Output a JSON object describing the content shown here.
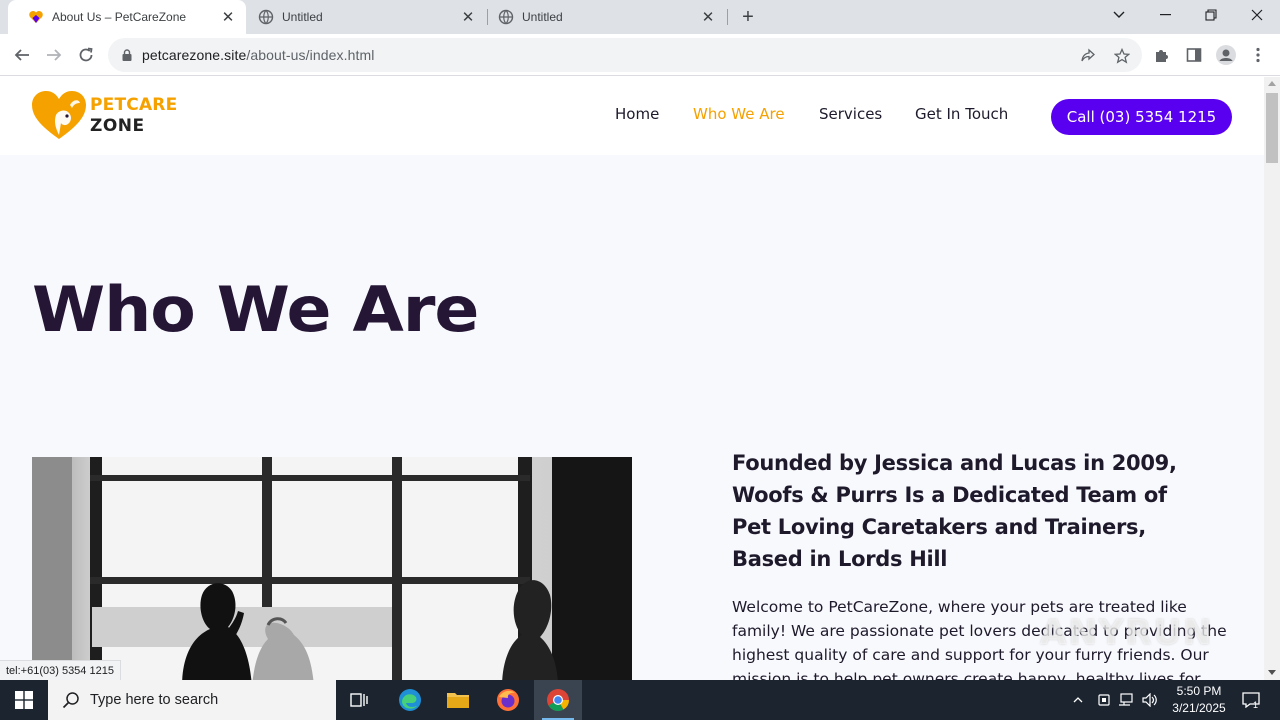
{
  "browser": {
    "tabs": [
      {
        "title": "About Us – PetCareZone",
        "active": true
      },
      {
        "title": "Untitled",
        "active": false
      },
      {
        "title": "Untitled",
        "active": false
      }
    ],
    "url_domain": "petcarezone.site",
    "url_path": "/about-us/index.html",
    "status_text": "tel:+61(03) 5354 1215"
  },
  "site": {
    "logo_line1": "PETCARE",
    "logo_line2": "ZONE",
    "nav": [
      "Home",
      "Who We Are",
      "Services",
      "Get In Touch"
    ],
    "active_nav": "Who We Are",
    "cta_label": "Call (03) 5354 1215",
    "hero_title": "Who We Are",
    "founded_heading": "Founded by Jessica and Lucas in 2009, Woofs & Purrs Is a Dedicated Team of Pet Loving Caretakers and Trainers, Based in Lords Hill",
    "welcome_text": "Welcome to PetCareZone, where your pets are treated like family! We are passionate pet lovers dedicated to providing the highest quality of care and support for your furry friends. Our mission is to help pet owners create happy, healthy lives for",
    "watermark": "ANYRUN"
  },
  "taskbar": {
    "search_placeholder": "Type here to search",
    "time": "5:50 PM",
    "date": "3/21/2025",
    "notification_count": "1"
  },
  "colors": {
    "accent_orange": "#f5a100",
    "cta_purple": "#5a00f0",
    "heading_dark": "#241634",
    "page_bg": "#f8f9fd"
  }
}
